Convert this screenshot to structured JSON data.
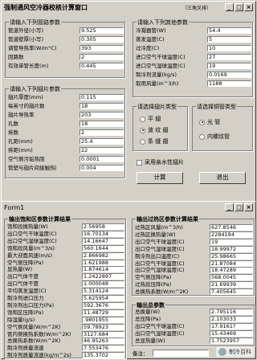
{
  "win1": {
    "title": "强制通风空冷器校核计算窗口",
    "subtitle": "（三角叉排）",
    "controls": [
      "_",
      "□",
      "×"
    ],
    "group_bundle": {
      "title": "请输入下列管路参数",
      "rows": [
        {
          "label": "管道外径(小写)",
          "value": "9.525"
        },
        {
          "label": "管道壁厚(小写)",
          "value": "0.305"
        },
        {
          "label": "调管导热率(W/m°C)",
          "value": "393"
        },
        {
          "label": "回路数",
          "value": "2"
        },
        {
          "label": "有效单管长度(m)",
          "value": "0.445"
        }
      ]
    },
    "group_fin": {
      "title": "请输入下列翅片参数",
      "rows": [
        {
          "label": "翅片厚度(mm)",
          "value": "0.115"
        },
        {
          "label": "每英寸的翅片数",
          "value": "18"
        },
        {
          "label": "翅片导热率",
          "value": "203"
        },
        {
          "label": "孔数",
          "value": "18"
        },
        {
          "label": "排数",
          "value": "2"
        },
        {
          "label": "孔距(mm)",
          "value": "25.4"
        },
        {
          "label": "排距(mm)",
          "value": "22"
        },
        {
          "label": "空气侧污垢热阻",
          "value": "0.0001"
        },
        {
          "label": "管壁与翅片间接触热阻",
          "value": "0.004"
        }
      ]
    },
    "group_other": {
      "title": "请输入下列其他参数",
      "rows": [
        {
          "label": "冷凝器管(W)",
          "value": "54.4"
        },
        {
          "label": "蒸发温度(C)",
          "value": "5"
        },
        {
          "label": "过冷度(C)",
          "value": "10"
        },
        {
          "label": "进口空气干球温度(C)",
          "value": "27"
        },
        {
          "label": "进口空气湿球温度(C)",
          "value": "19"
        },
        {
          "label": "制冷剂流量(kg/s)",
          "value": "0.0169"
        },
        {
          "label": "取用风量(m^3/h)",
          "value": "1188"
        }
      ]
    },
    "group_fintype": {
      "title": "请选择翅片类型",
      "options": [
        {
          "label": "平 翅",
          "selected": false
        },
        {
          "label": "波 纹 翅",
          "selected": true
        },
        {
          "label": "条 缝 翅",
          "selected": false
        }
      ]
    },
    "group_tubetype": {
      "title": "请选择铜管类型",
      "options": [
        {
          "label": "光 管",
          "selected": true
        },
        {
          "label": "内螺纹管",
          "selected": false
        }
      ]
    },
    "checkbox_label": "采用亲水性翅片",
    "calc_button": "计算",
    "exit_button": "退出"
  },
  "win2": {
    "title": "Form1",
    "controls": [
      "_",
      "□",
      "×"
    ],
    "group_twophase": {
      "title": "输出饱和区参数计算结果",
      "rows": [
        {
          "label": "饱和段换热量(W)",
          "value": "2.56958"
        },
        {
          "label": "出口空气干球温度(C)",
          "value": "16.70134"
        },
        {
          "label": "出口空气湿球温度(C)",
          "value": "14.16647"
        },
        {
          "label": "饱和段风量(m^3/s)",
          "value": "560.1644"
        },
        {
          "label": "最大迎面风速(m/s)",
          "value": "2.866982"
        },
        {
          "label": "空气侧压降(Pa)",
          "value": "1.621988"
        },
        {
          "label": "显热量(W)",
          "value": "1.874614"
        },
        {
          "label": "出口气体干度",
          "value": "1.2422897"
        },
        {
          "label": "出口气体干度",
          "value": "1.000048"
        },
        {
          "label": "平均蒸发温度(C)",
          "value": "5.314124"
        },
        {
          "label": "制冷剂进口压力",
          "value": "5.625954"
        },
        {
          "label": "制冷剂出口压力(Pa)",
          "value": "592.3676"
        },
        {
          "label": "饱和区压降(Pa)",
          "value": "11.48729"
        },
        {
          "label": "除湿量(g/s)",
          "value": ".9801955"
        },
        {
          "label": "空气侧风量(W/m^2K)",
          "value": "59.78923"
        },
        {
          "label": "管内侧换热系数(W/m^2K)",
          "value": "3127.684"
        },
        {
          "label": "总换热系数(W/m^2K)",
          "value": "46.95263"
        },
        {
          "label": "制冷剂质量流速",
          "value": "7.553476"
        },
        {
          "label": "制冷剂质量流速(kg/m^2s)",
          "value": "135.3702"
        }
      ]
    },
    "group_superheat": {
      "title": "输出过热区参数计算结果",
      "rows": [
        {
          "label": "过热区风量(m^3/h)",
          "value": "627.8546"
        },
        {
          "label": "过热区换热量(W)",
          "value": "2284194"
        },
        {
          "label": "出口空气干球温度(C)",
          "value": "19"
        },
        {
          "label": "出口空气湿球温度(C)",
          "value": "18.99972"
        },
        {
          "label": "制冷剂出口温度(C)",
          "value": "25.98665"
        },
        {
          "label": "出口空气干球温度(C)",
          "value": "21.87084"
        },
        {
          "label": "出口空气湿球温度(C)",
          "value": "18.47289"
        },
        {
          "label": "空气侧压降(Pa)",
          "value": "568.0045"
        },
        {
          "label": "过热段压降(Pa)",
          "value": "21.69939"
        },
        {
          "label": "总换热系数(W/m^2K)",
          "value": "7.405645"
        }
      ]
    },
    "group_total": {
      "title": "输出总参数",
      "rows": [
        {
          "label": "总换量(W)",
          "value": "2.795116"
        },
        {
          "label": "总压降(Pa)",
          "value": "2.103033"
        },
        {
          "label": "出口空气干球温度(C)",
          "value": "17.9161?"
        },
        {
          "label": "出口空气湿球温度(C)",
          "value": "15.43469"
        },
        {
          "label": "总显热量(W)",
          "value": "1.7523957"
        }
      ]
    },
    "note_label": "备注："
  },
  "watermark": "制冷百科"
}
